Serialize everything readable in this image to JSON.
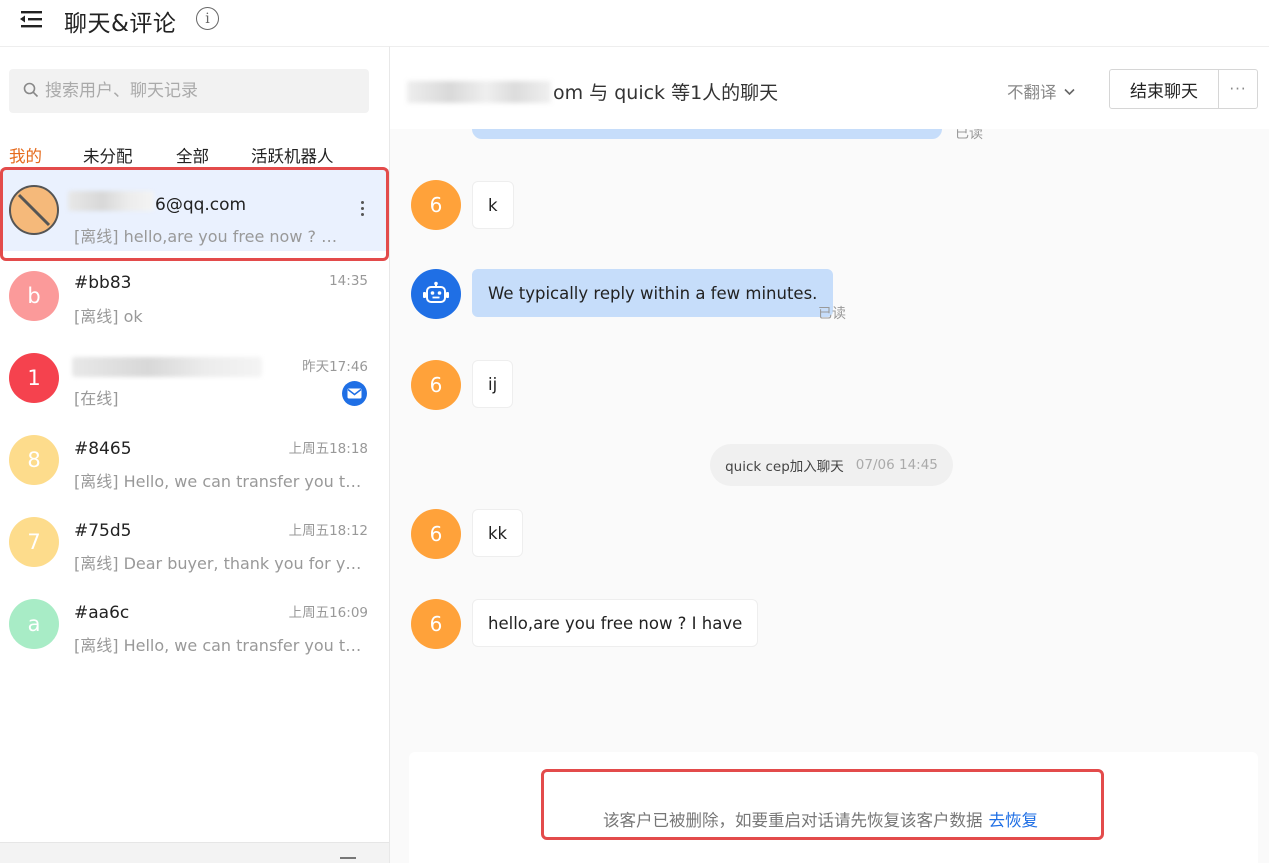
{
  "header": {
    "title": "聊天&评论",
    "menu_icon": "menu-collapse-icon",
    "info_icon": "info-icon",
    "info_glyph": "i"
  },
  "sidebar": {
    "search": {
      "placeholder": "搜索用户、聊天记录"
    },
    "tabs": [
      {
        "label": "我的",
        "active": true
      },
      {
        "label": "未分配",
        "active": false
      },
      {
        "label": "全部",
        "active": false
      },
      {
        "label": "活跃机器人",
        "active": false
      }
    ],
    "conversations": [
      {
        "name_visible": "6@qq.com",
        "avatar": "",
        "avatar_color": "#f5b97a",
        "preview": "[离线] hello,are you free now ? I have",
        "time": "",
        "selected": true,
        "blocked": true
      },
      {
        "name": "#bb83",
        "avatar": "b",
        "avatar_color": "#fb9a9a",
        "preview": "[离线] ok",
        "time": "14:35"
      },
      {
        "name": "",
        "avatar": "1",
        "avatar_color": "#f5424e",
        "preview": "[在线]",
        "time": "昨天17:46",
        "has_mail_badge": true
      },
      {
        "name": "#8465",
        "avatar": "8",
        "avatar_color": "#fddc8c",
        "preview": "[离线] Hello, we can transfer you to a human agent.",
        "time": "上周五18:18"
      },
      {
        "name": "#75d5",
        "avatar": "7",
        "avatar_color": "#fddc8c",
        "preview": "[离线] Dear buyer, thank you for your message.",
        "time": "上周五18:12"
      },
      {
        "name": "#aa6c",
        "avatar": "a",
        "avatar_color": "#a8ecc6",
        "preview": "[离线] Hello, we can transfer you to a human agent.",
        "time": "上周五16:09"
      }
    ]
  },
  "chat": {
    "title_suffix": "om 与 quick 等1人的聊天",
    "translate_label": "不翻译",
    "end_chat_label": "结束聊天",
    "more_label": "···",
    "messages": [
      {
        "sender": "customer",
        "avatar": "6",
        "text": "k"
      },
      {
        "sender": "bot",
        "text": "We typically reply within a few minutes.",
        "read": "已读"
      },
      {
        "sender": "customer",
        "avatar": "6",
        "text": "ij"
      },
      {
        "sender": "system",
        "text": "quick cep加入聊天",
        "time": "07/06 14:45"
      },
      {
        "sender": "customer",
        "avatar": "6",
        "text": "kk"
      },
      {
        "sender": "customer",
        "avatar": "6",
        "text": "hello,are you free now ? I have"
      }
    ],
    "top_read": "已读",
    "deleted_notice": "该客户已被删除，如要重启对话请先恢复该客户数据",
    "restore_link": "去恢复"
  },
  "colors": {
    "accent": "#e56a1c",
    "link": "#1f6fe5",
    "highlight": "#e34b4b",
    "customer_avatar": "#ffa23a",
    "bot_avatar": "#1f6fe5"
  }
}
